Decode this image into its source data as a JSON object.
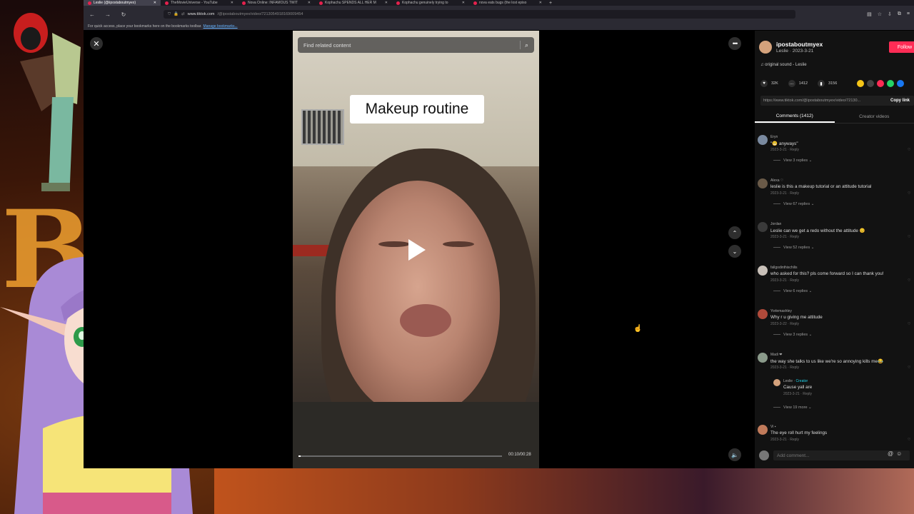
{
  "browser": {
    "tabs": [
      {
        "label": "Leslie (@iipostaboutmyex)",
        "active": true
      },
      {
        "label": "TheMovieUniverse - YouTube",
        "active": false
      },
      {
        "label": "Nova Online: INFAMOUS TWIT",
        "active": false
      },
      {
        "label": "Kophachu SPENDS ALL HER M",
        "active": false
      },
      {
        "label": "Kophachu genuinely trying to",
        "active": false
      },
      {
        "label": "nova eats bugs (the lost episo",
        "active": false
      }
    ],
    "new_tab": "+",
    "url_host": "www.tiktok.com",
    "url_path": "/@ipostaboutmyex/video/7213054918169009454",
    "bookmarks_text": "For quick access, place your bookmarks here on the bookmarks toolbar.",
    "bookmarks_link": "Manage bookmarks..."
  },
  "video": {
    "search_placeholder": "Find related content",
    "caption": "Makeup routine",
    "time": "00:10/00:28",
    "progress_fraction": 0.01
  },
  "panel": {
    "username": "ipostaboutmyex",
    "subline": "Leslie · 2023-3-21",
    "follow": "Follow",
    "sound": "original sound - Leslie",
    "likes": "32K",
    "comments_count": "1412",
    "saves": "3156",
    "link": "https://www.tiktok.com/@ipostaboutmyex/video/72130...",
    "copy_link": "Copy link",
    "tab_comments": "Comments (1412)",
    "tab_videos": "Creator videos",
    "add_comment": "Add comment...",
    "comments": [
      {
        "user": "Eryn",
        "text": "\"😬 anyways\"",
        "meta": "2023-3-21 · Reply",
        "replies": "View 3 replies ⌄"
      },
      {
        "user": "Alexa ♡",
        "text": "leslie is this a makeup tutorial or an attitude tutorial",
        "meta": "2023-3-21 · Reply",
        "replies": "View 67 replies ⌄"
      },
      {
        "user": "Jordan",
        "text": "Leslie can we get a redo without the attitude 😊",
        "meta": "2023-3-21 · Reply",
        "replies": "View 52 replies ⌄"
      },
      {
        "user": "fallgodinthischilis",
        "text": "who asked for this? pls come forward so I can thank you!",
        "meta": "2023-3-21 · Reply",
        "replies": "View 6 replies ⌄"
      },
      {
        "user": "Yorlemashley",
        "text": "Why r u giving me attitude",
        "meta": "2023-3-22 · Reply",
        "replies": "View 3 replies ⌄"
      },
      {
        "user": "Madi ❤",
        "text": "the way she talks to us like we're so annoying kills me😂",
        "meta": "2023-3-21 · Reply",
        "replies": "View 19 more ⌄"
      },
      {
        "user": "Vi ▪",
        "text": "The eye roll hurt my feelings",
        "meta": "2023-3-21 · Reply",
        "replies": ""
      }
    ],
    "reply": {
      "user": "Leslie",
      "creator": "Creator",
      "text": "Cause yall are",
      "meta": "2023-3-21 · Reply"
    }
  },
  "colors": {
    "follow": "#fe2c55",
    "creator_tag": "#20d5ec"
  }
}
